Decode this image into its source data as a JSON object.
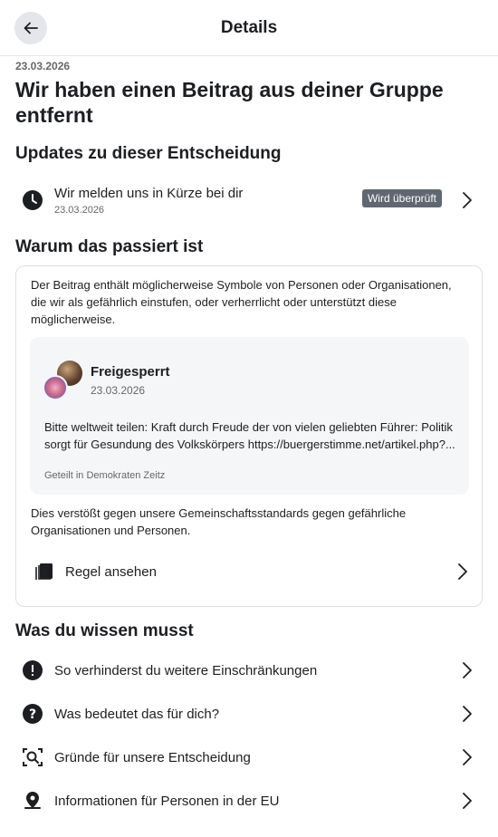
{
  "header": {
    "title": "Details"
  },
  "notice": {
    "date": "23.03.2026",
    "title": "Wir haben einen Beitrag aus deiner Gruppe entfernt"
  },
  "updates": {
    "heading": "Updates zu dieser Entscheidung",
    "item": {
      "title": "Wir melden uns in Kürze bei dir",
      "date": "23.03.2026",
      "status": "Wird überprüft"
    }
  },
  "why": {
    "heading": "Warum das passiert ist",
    "explanation": "Der Beitrag enthält möglicherweise Symbole von Personen oder Organisationen, die wir als gefährlich einstufen, oder verherrlicht oder unterstützt diese möglicherweise.",
    "post": {
      "author": "Freigesperrt",
      "date": "23.03.2026",
      "text": "Bitte weltweit teilen: Kraft durch Freude der von vielen geliebten Führer: Politik sorgt für Gesundung des Volkskörpers https://buergerstimme.net/artikel.php?...",
      "shared_in": "Geteilt in Demokraten Zeitz"
    },
    "violation": "Dies verstößt gegen unsere Gemeinschaftsstandards gegen gefährliche Organisationen und Personen.",
    "rule_link": "Regel ansehen"
  },
  "know": {
    "heading": "Was du wissen musst",
    "items": [
      {
        "label": "So verhinderst du weitere Einschränkungen",
        "icon": "exclamation-icon"
      },
      {
        "label": "Was bedeutet das für dich?",
        "icon": "question-icon"
      },
      {
        "label": "Gründe für unsere Entscheidung",
        "icon": "search-icon"
      },
      {
        "label": "Informationen für Personen in der EU",
        "icon": "location-pin-icon"
      }
    ]
  }
}
